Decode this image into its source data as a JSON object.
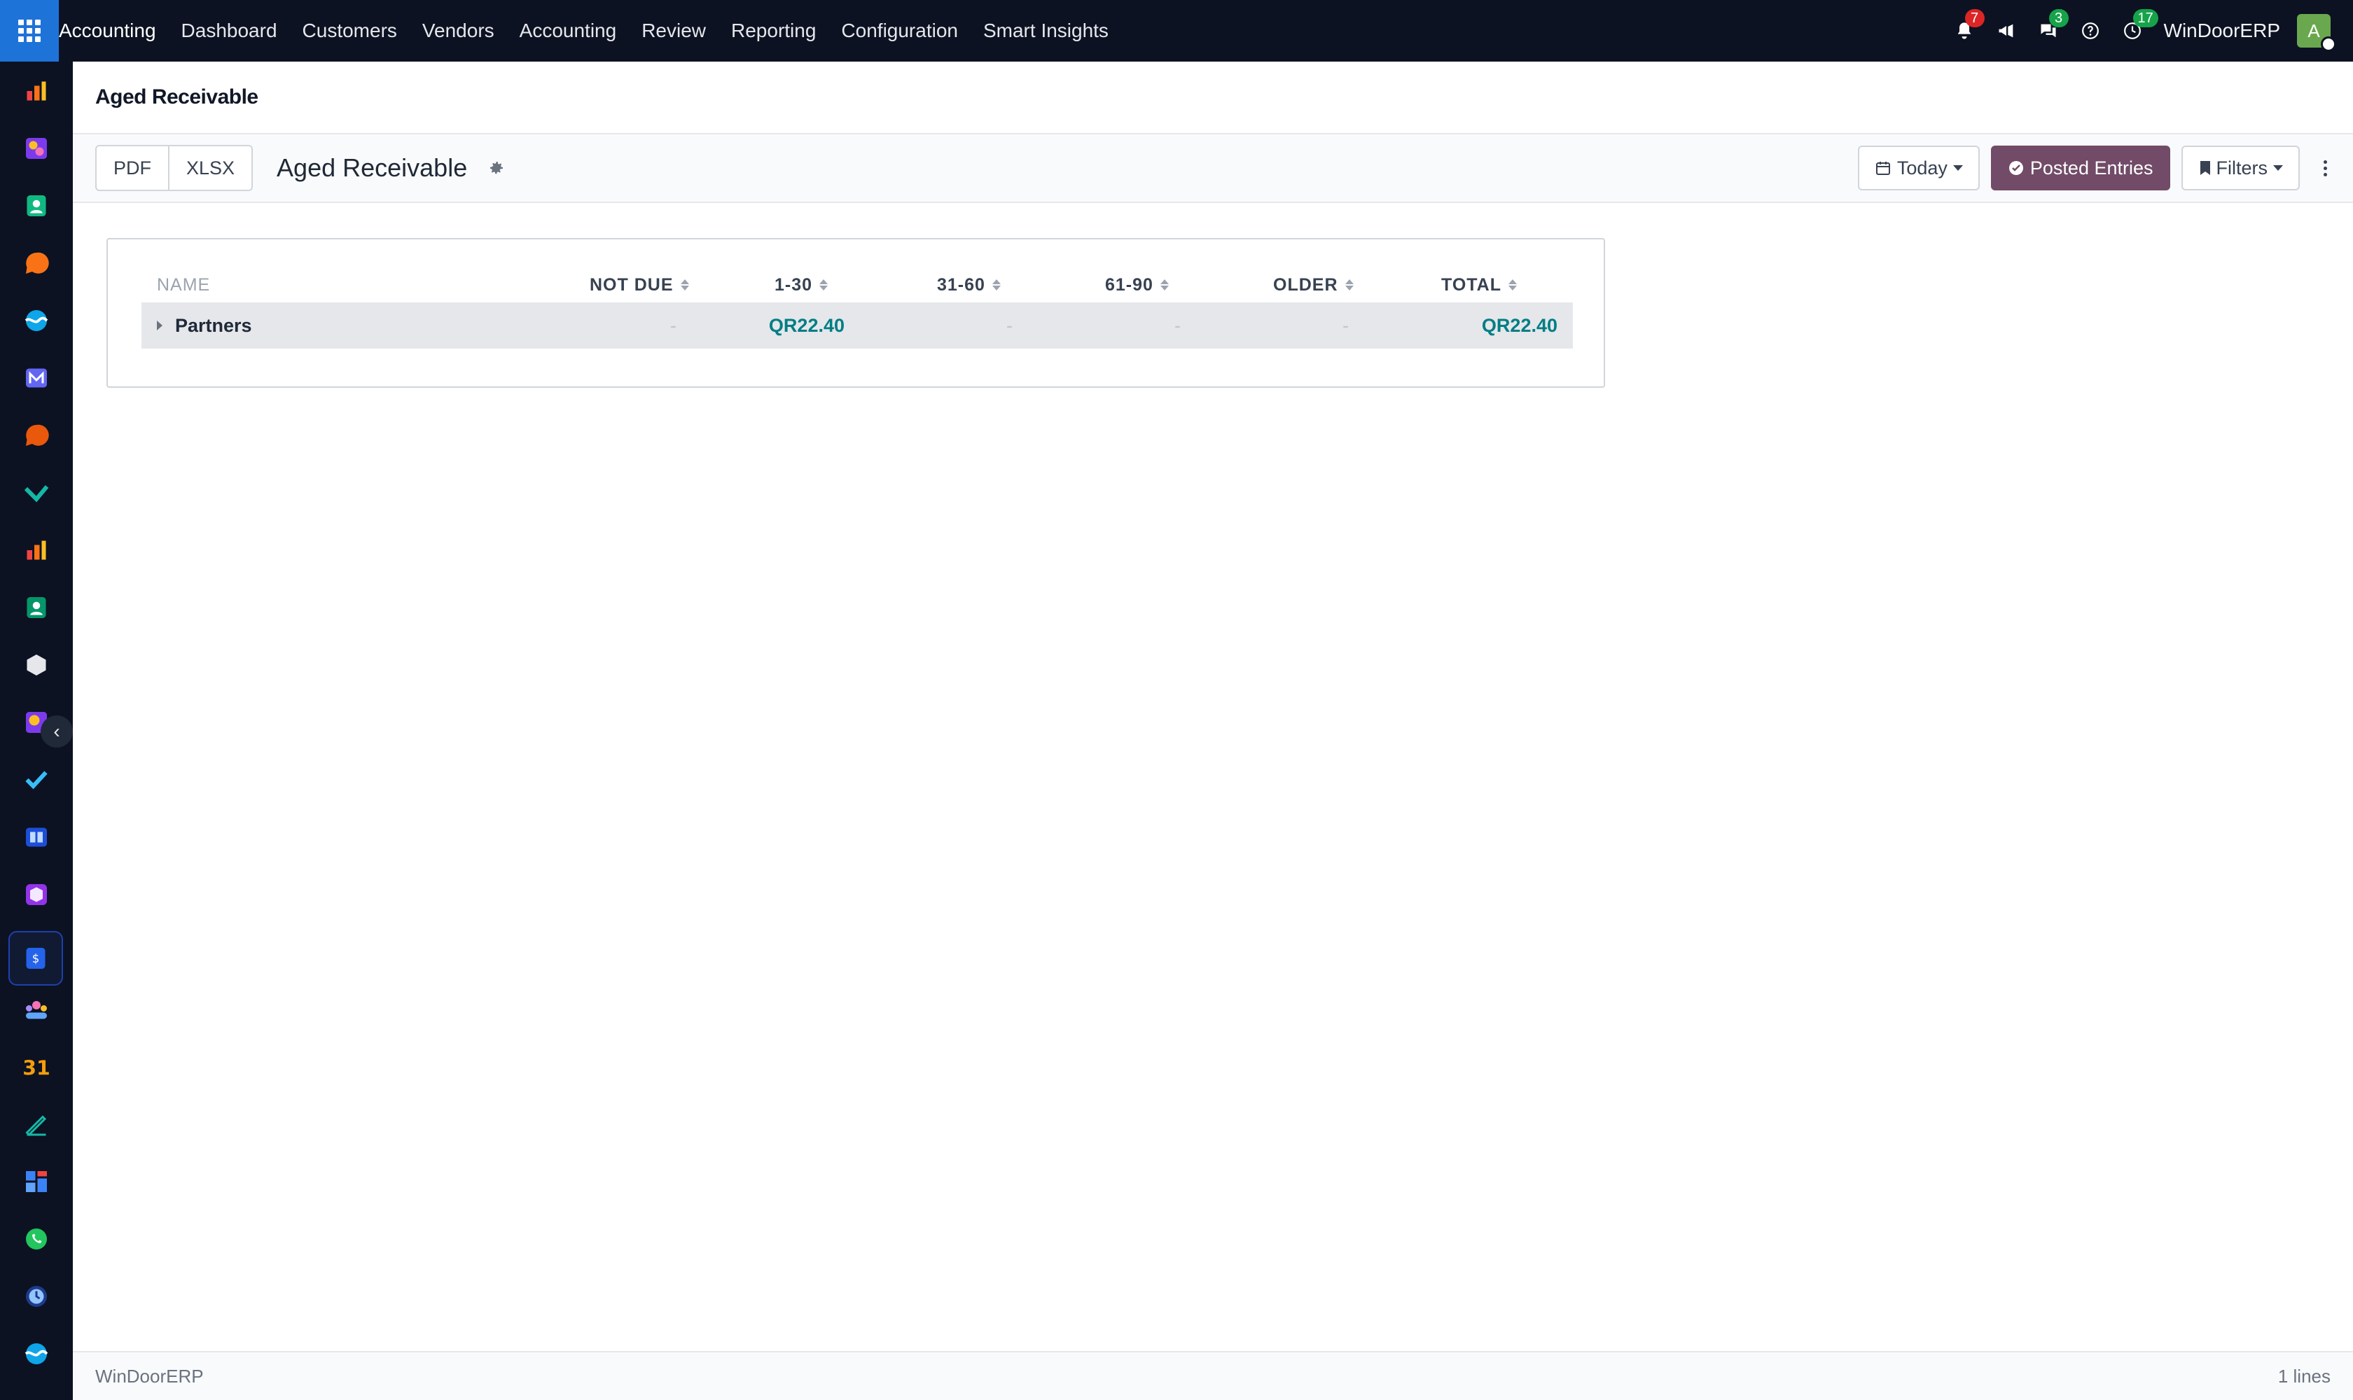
{
  "topbar": {
    "app_name": "Accounting",
    "menu": [
      "Dashboard",
      "Customers",
      "Vendors",
      "Accounting",
      "Review",
      "Reporting",
      "Configuration",
      "Smart Insights"
    ],
    "notifications_count": "7",
    "messages_count": "3",
    "activities_count": "17",
    "company": "WinDoorERP",
    "avatar_letter": "A"
  },
  "sidebar": {
    "apps": [
      {
        "icon": "bar-chart-icon",
        "color": "#f97316"
      },
      {
        "icon": "media-icon",
        "color": "#a78bfa"
      },
      {
        "icon": "contacts-icon",
        "color": "#10b981"
      },
      {
        "icon": "discuss-icon",
        "color": "#f97316"
      },
      {
        "icon": "wave-icon",
        "color": "#22d3ee"
      },
      {
        "icon": "mail-icon",
        "color": "#6366f1"
      },
      {
        "icon": "chat-icon",
        "color": "#f97316"
      },
      {
        "icon": "check-icon",
        "color": "#14b8a6"
      },
      {
        "icon": "sales-chart-icon",
        "color": "#f97316"
      },
      {
        "icon": "employee-icon",
        "color": "#10b981"
      },
      {
        "icon": "cube-icon",
        "color": "#e5e7eb"
      },
      {
        "icon": "tools-icon",
        "color": "#fbbf24"
      },
      {
        "icon": "checkmark-icon",
        "color": "#38bdf8"
      },
      {
        "icon": "knowledge-icon",
        "color": "#60a5fa"
      },
      {
        "icon": "inventory-icon",
        "color": "#c084fc"
      },
      {
        "icon": "invoicing-icon",
        "color": "#3b82f6"
      },
      {
        "icon": "team-icon",
        "color": "#f472b6"
      },
      {
        "icon": "calendar-icon",
        "color": "#f59e0b",
        "text": "31"
      },
      {
        "icon": "sign-icon",
        "color": "#14b8a6"
      },
      {
        "icon": "dashboard-icon",
        "color": "#3b82f6"
      },
      {
        "icon": "whatsapp-icon",
        "color": "#22c55e"
      },
      {
        "icon": "clock-icon",
        "color": "#60a5fa"
      },
      {
        "icon": "wave2-icon",
        "color": "#22d3ee"
      }
    ]
  },
  "breadcrumb": "Aged Receivable",
  "controls": {
    "pdf_label": "PDF",
    "xlsx_label": "XLSX",
    "report_title": "Aged Receivable",
    "date_filter": "Today",
    "posted_entries": "Posted Entries",
    "filters": "Filters"
  },
  "table": {
    "headers": [
      "NAME",
      "NOT DUE",
      "1-30",
      "31-60",
      "61-90",
      "OLDER",
      "TOTAL"
    ],
    "rows": [
      {
        "name": "Partners",
        "not_due": "-",
        "d1_30": "QR22.40",
        "d31_60": "-",
        "d61_90": "-",
        "older": "-",
        "total": "QR22.40"
      }
    ]
  },
  "footer": {
    "company": "WinDoorERP",
    "lines": "1 lines"
  },
  "colors": {
    "topbar_bg": "#0c1222",
    "apps_button": "#1e73d8",
    "primary_button": "#714b67",
    "amount_text": "#017e84"
  }
}
